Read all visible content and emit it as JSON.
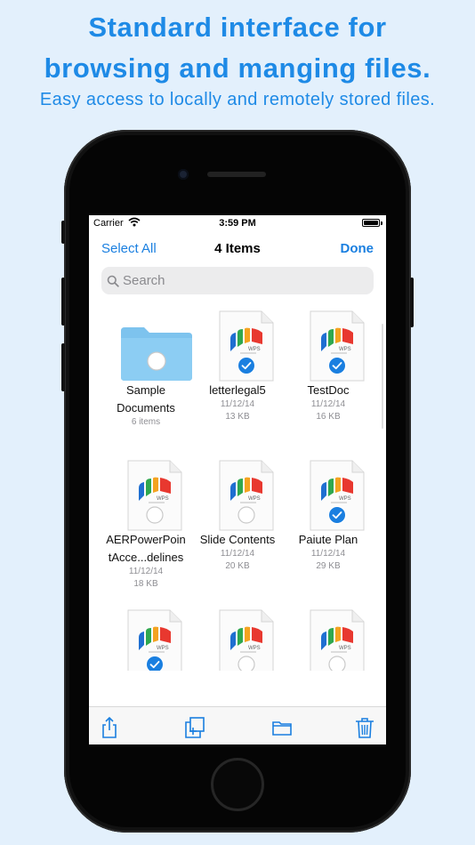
{
  "promo": {
    "headline_line1": "Standard interface for",
    "headline_line2": "browsing and manging files.",
    "subline": "Easy access to locally and remotely stored files."
  },
  "statusbar": {
    "carrier": "Carrier",
    "time": "3:59 PM"
  },
  "navbar": {
    "select_all": "Select All",
    "title": "4 Items",
    "done": "Done"
  },
  "search": {
    "placeholder": "Search"
  },
  "items": [
    {
      "kind": "folder",
      "name1": "Sample",
      "name2": "Documents",
      "date": "",
      "size": "6 items",
      "checked": false
    },
    {
      "kind": "doc",
      "name1": "letterlegal5",
      "name2": "",
      "date": "11/12/14",
      "size": "13 KB",
      "checked": true
    },
    {
      "kind": "doc",
      "name1": "TestDoc",
      "name2": "",
      "date": "11/12/14",
      "size": "16 KB",
      "checked": true
    },
    {
      "kind": "doc",
      "name1": "AERPowerPoin",
      "name2": "tAcce...delines",
      "date": "11/12/14",
      "size": "18 KB",
      "checked": false
    },
    {
      "kind": "doc",
      "name1": "Slide Contents",
      "name2": "",
      "date": "11/12/14",
      "size": "20 KB",
      "checked": false
    },
    {
      "kind": "doc",
      "name1": "Paiute Plan",
      "name2": "",
      "date": "11/12/14",
      "size": "29 KB",
      "checked": true
    },
    {
      "kind": "doc",
      "name1": "",
      "name2": "",
      "date": "",
      "size": "",
      "checked": true
    },
    {
      "kind": "doc",
      "name1": "",
      "name2": "",
      "date": "",
      "size": "",
      "checked": false
    },
    {
      "kind": "doc",
      "name1": "",
      "name2": "",
      "date": "",
      "size": "",
      "checked": false
    }
  ],
  "doc_badge": "WPS",
  "colors": {
    "accent": "#1a7fe0",
    "promo_text": "#1e8ae6",
    "folder": "#7dc3ee",
    "logo_blue": "#1f6fd1",
    "logo_green": "#2fa84f",
    "logo_orange": "#f4a320",
    "logo_red": "#e8382f"
  },
  "toolbar": {
    "icons": [
      "share-icon",
      "duplicate-icon",
      "move-to-folder-icon",
      "trash-icon"
    ]
  }
}
